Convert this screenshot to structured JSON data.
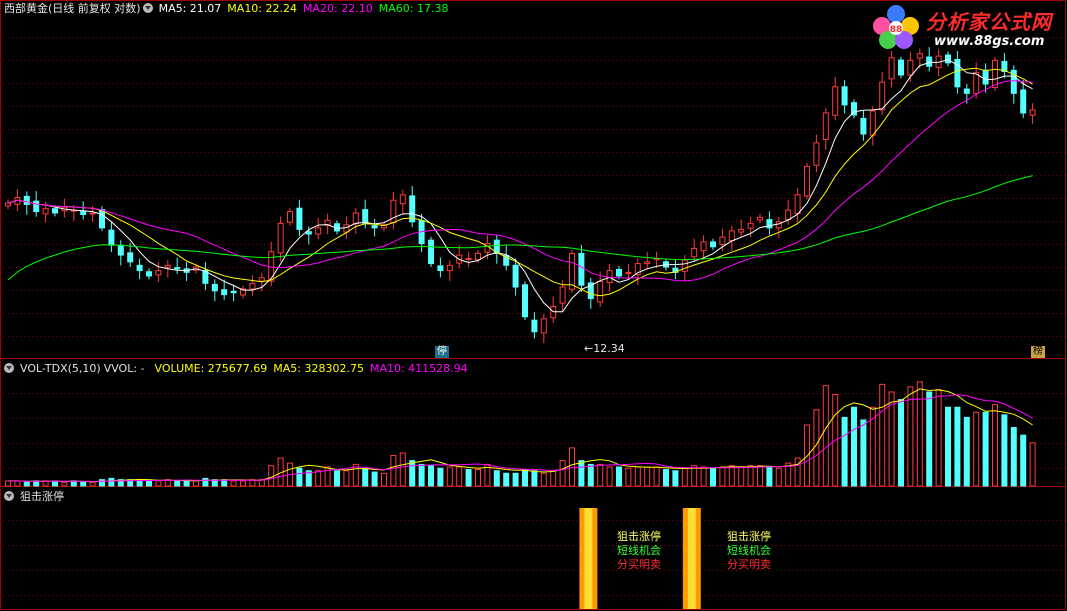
{
  "header": {
    "stock_title": "西部黄金(日线 前复权 对数)",
    "ma5": "MA5: 21.07",
    "ma10": "MA10: 22.24",
    "ma20": "MA20: 22.10",
    "ma60": "MA60: 17.38"
  },
  "volume_header": {
    "name": "VOL-TDX(5,10)",
    "vvol": "VVOL: -",
    "volume": "VOLUME: 275677.69",
    "ma5": "MA5: 328302.75",
    "ma10": "MA10: 411528.94"
  },
  "indicator_header": {
    "name": "狙击涨停"
  },
  "logo": {
    "title": "分析家公式网",
    "url": "www.88gs.com"
  },
  "markers": {
    "low_label": "12.34",
    "stop_tag": "停",
    "rank_tag": "榜"
  },
  "signals": [
    {
      "line1": "狙击涨停",
      "line2": "短线机会",
      "line3": "分买明卖"
    },
    {
      "line1": "狙击涨停",
      "line2": "短线机会",
      "line3": "分买明卖"
    }
  ],
  "colors": {
    "up": "#ff3a3a",
    "down": "#54ffff",
    "ma5": "#ffffff",
    "ma10": "#ffff00",
    "ma20": "#ff00ff",
    "ma60": "#00ff00",
    "grid": "#7a0000",
    "signal_bar": "#ff9900"
  },
  "chart_data": {
    "type": "candlestick",
    "closes": [
      20.2,
      20.6,
      20.1,
      19.6,
      19.8,
      19.5,
      19.9,
      19.7,
      19.4,
      19.5,
      18.5,
      17.4,
      16.8,
      16.4,
      15.9,
      15.6,
      15.9,
      16.2,
      16.0,
      15.8,
      16.1,
      15.2,
      14.8,
      14.6,
      14.7,
      14.9,
      15.2,
      15.5,
      17.0,
      18.8,
      19.6,
      18.4,
      18.1,
      18.5,
      19.0,
      18.3,
      18.7,
      19.5,
      18.8,
      18.5,
      18.7,
      20.4,
      20.8,
      18.9,
      17.5,
      16.3,
      15.9,
      16.2,
      16.8,
      16.6,
      16.9,
      17.5,
      16.9,
      16.2,
      15.0,
      13.5,
      12.8,
      13.4,
      14.0,
      15.0,
      16.9,
      15.1,
      14.4,
      15.3,
      15.9,
      15.6,
      15.8,
      16.3,
      16.4,
      16.6,
      16.1,
      15.8,
      16.5,
      17.2,
      17.6,
      17.3,
      17.9,
      18.3,
      18.4,
      18.8,
      19.2,
      18.5,
      18.9,
      19.7,
      20.8,
      23.0,
      25.0,
      27.8,
      30.5,
      28.6,
      27.6,
      25.8,
      28.0,
      31.0,
      33.8,
      31.8,
      33.5,
      34.3,
      32.8,
      34.0,
      33.2,
      30.5,
      29.8,
      32.1,
      30.8,
      33.5,
      32.2,
      29.8,
      27.8,
      28.1
    ],
    "volumes": [
      0.04,
      0.04,
      0.03,
      0.04,
      0.04,
      0.04,
      0.03,
      0.04,
      0.03,
      0.03,
      0.05,
      0.06,
      0.05,
      0.05,
      0.05,
      0.04,
      0.04,
      0.05,
      0.04,
      0.04,
      0.04,
      0.06,
      0.05,
      0.05,
      0.04,
      0.04,
      0.05,
      0.05,
      0.16,
      0.22,
      0.18,
      0.14,
      0.12,
      0.12,
      0.15,
      0.12,
      0.12,
      0.17,
      0.13,
      0.11,
      0.1,
      0.24,
      0.26,
      0.2,
      0.17,
      0.16,
      0.14,
      0.15,
      0.15,
      0.13,
      0.13,
      0.17,
      0.12,
      0.1,
      0.1,
      0.13,
      0.12,
      0.1,
      0.12,
      0.2,
      0.3,
      0.2,
      0.17,
      0.17,
      0.15,
      0.15,
      0.14,
      0.15,
      0.15,
      0.15,
      0.13,
      0.12,
      0.14,
      0.16,
      0.15,
      0.14,
      0.15,
      0.16,
      0.15,
      0.16,
      0.16,
      0.15,
      0.14,
      0.18,
      0.22,
      0.48,
      0.6,
      0.79,
      0.72,
      0.54,
      0.62,
      0.52,
      0.62,
      0.8,
      0.74,
      0.68,
      0.78,
      0.82,
      0.74,
      0.76,
      0.62,
      0.62,
      0.54,
      0.58,
      0.58,
      0.64,
      0.56,
      0.46,
      0.4,
      0.34
    ],
    "x_signal_indices": [
      61,
      72
    ],
    "y_price_range": [
      12.0,
      36.0
    ]
  }
}
